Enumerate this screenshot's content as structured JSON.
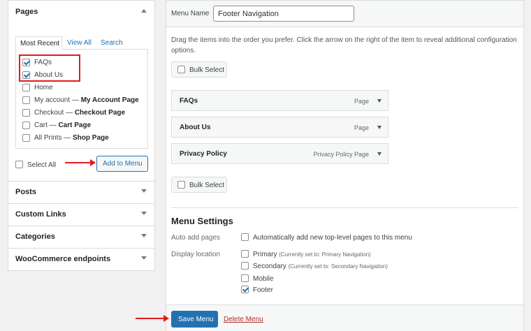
{
  "left": {
    "pages_title": "Pages",
    "tabs": [
      "Most Recent",
      "View All",
      "Search"
    ],
    "pages": [
      {
        "label": "FAQs",
        "suffix": "",
        "checked": true
      },
      {
        "label": "About Us",
        "suffix": "",
        "checked": true
      },
      {
        "label": "Home",
        "suffix": "",
        "checked": false
      },
      {
        "label": "My account — ",
        "suffix": "My Account Page",
        "checked": false
      },
      {
        "label": "Checkout — ",
        "suffix": "Checkout Page",
        "checked": false
      },
      {
        "label": "Cart — ",
        "suffix": "Cart Page",
        "checked": false
      },
      {
        "label": "All Prints — ",
        "suffix": "Shop Page",
        "checked": false
      }
    ],
    "select_all": "Select All",
    "add_to_menu": "Add to Menu",
    "sections": [
      "Posts",
      "Custom Links",
      "Categories",
      "WooCommerce endpoints"
    ]
  },
  "right": {
    "menu_name_label": "Menu Name",
    "menu_name_value": "Footer Navigation",
    "instructions_line1": "Drag the items into the order you prefer. Click the arrow on the right of the item to reveal additional configuration",
    "instructions_line2": "options.",
    "bulk_select": "Bulk Select",
    "items": [
      {
        "title": "FAQs",
        "type": "Page"
      },
      {
        "title": "About Us",
        "type": "Page"
      },
      {
        "title": "Privacy Policy",
        "type": "Privacy Policy Page"
      }
    ],
    "settings_title": "Menu Settings",
    "auto_add_label": "Auto add pages",
    "auto_add_option": "Automatically add new top-level pages to this menu",
    "display_location_label": "Display location",
    "locations": [
      {
        "name": "Primary",
        "note": "(Currently set to: Primary Navigation)",
        "checked": false
      },
      {
        "name": "Secondary",
        "note": "(Currently set to: Secondary Navigation)",
        "checked": false
      },
      {
        "name": "Mobile",
        "note": "",
        "checked": false
      },
      {
        "name": "Footer",
        "note": "",
        "checked": true
      }
    ],
    "save_menu": "Save Menu",
    "delete_menu": "Delete Menu"
  },
  "colors": {
    "primary_button": "#2271b1",
    "delete_link": "#b32d2e",
    "highlight": "#e21b1b"
  }
}
